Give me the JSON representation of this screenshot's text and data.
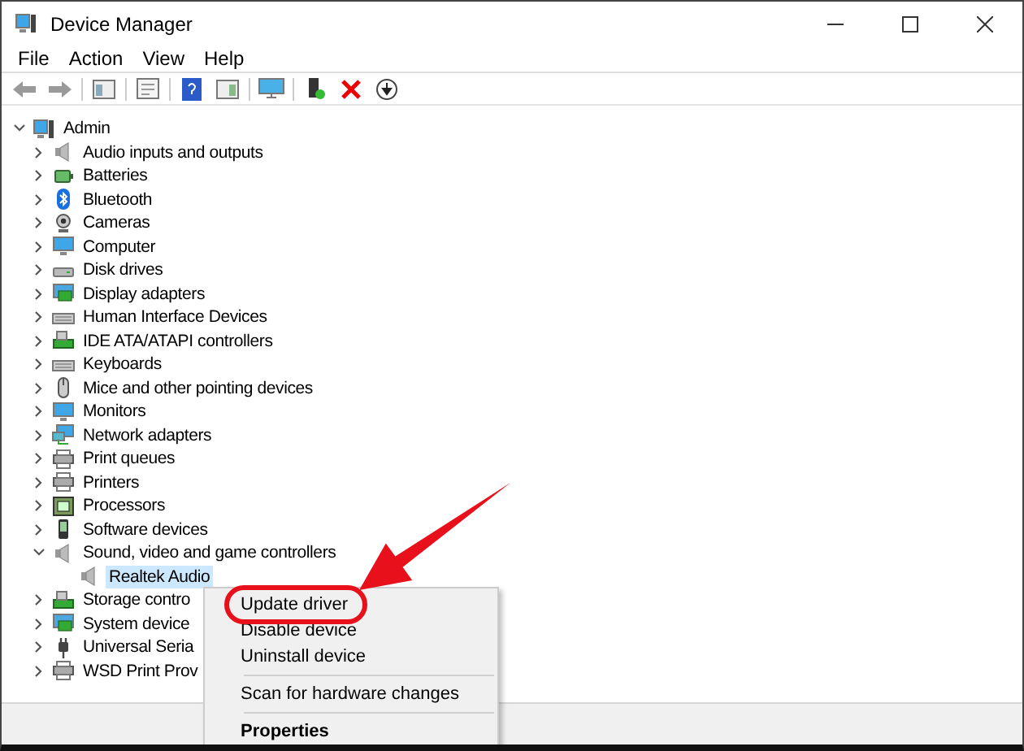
{
  "window": {
    "title": "Device Manager"
  },
  "menu": [
    "File",
    "Action",
    "View",
    "Help"
  ],
  "tree": {
    "label": "Admin",
    "expanded": true,
    "children": [
      {
        "label": "Audio inputs and outputs",
        "expanded": false,
        "selected": false
      },
      {
        "label": "Batteries",
        "expanded": false,
        "selected": false
      },
      {
        "label": "Bluetooth",
        "expanded": false,
        "selected": false
      },
      {
        "label": "Cameras",
        "expanded": false,
        "selected": false
      },
      {
        "label": "Computer",
        "expanded": false,
        "selected": false
      },
      {
        "label": "Disk drives",
        "expanded": false,
        "selected": false
      },
      {
        "label": "Display adapters",
        "expanded": false,
        "selected": false
      },
      {
        "label": "Human Interface Devices",
        "expanded": false,
        "selected": false
      },
      {
        "label": "IDE ATA/ATAPI controllers",
        "expanded": false,
        "selected": false
      },
      {
        "label": "Keyboards",
        "expanded": false,
        "selected": false
      },
      {
        "label": "Mice and other pointing devices",
        "expanded": false,
        "selected": false
      },
      {
        "label": "Monitors",
        "expanded": false,
        "selected": false
      },
      {
        "label": "Network adapters",
        "expanded": false,
        "selected": false
      },
      {
        "label": "Print queues",
        "expanded": false,
        "selected": false
      },
      {
        "label": "Printers",
        "expanded": false,
        "selected": false
      },
      {
        "label": "Processors",
        "expanded": false,
        "selected": false
      },
      {
        "label": "Software devices",
        "expanded": false,
        "selected": false
      },
      {
        "label": "Sound, video and game controllers",
        "expanded": true,
        "selected": false,
        "children": [
          {
            "label": "Realtek Audio",
            "selected": true
          }
        ]
      },
      {
        "label": "Storage contro",
        "expanded": false,
        "selected": false
      },
      {
        "label": "System device",
        "expanded": false,
        "selected": false
      },
      {
        "label": "Universal Seria",
        "expanded": false,
        "selected": false
      },
      {
        "label": "WSD Print Prov",
        "expanded": false,
        "selected": false
      }
    ]
  },
  "context_menu": {
    "items": [
      {
        "kind": "item",
        "label": "Update driver",
        "default": false,
        "highlighted": true
      },
      {
        "kind": "item",
        "label": "Disable device",
        "default": false,
        "highlighted": false
      },
      {
        "kind": "item",
        "label": "Uninstall device",
        "default": false,
        "highlighted": false
      },
      {
        "kind": "separator"
      },
      {
        "kind": "item",
        "label": "Scan for hardware changes",
        "default": false,
        "highlighted": false
      },
      {
        "kind": "separator"
      },
      {
        "kind": "item",
        "label": "Properties",
        "default": true,
        "highlighted": false
      }
    ]
  }
}
